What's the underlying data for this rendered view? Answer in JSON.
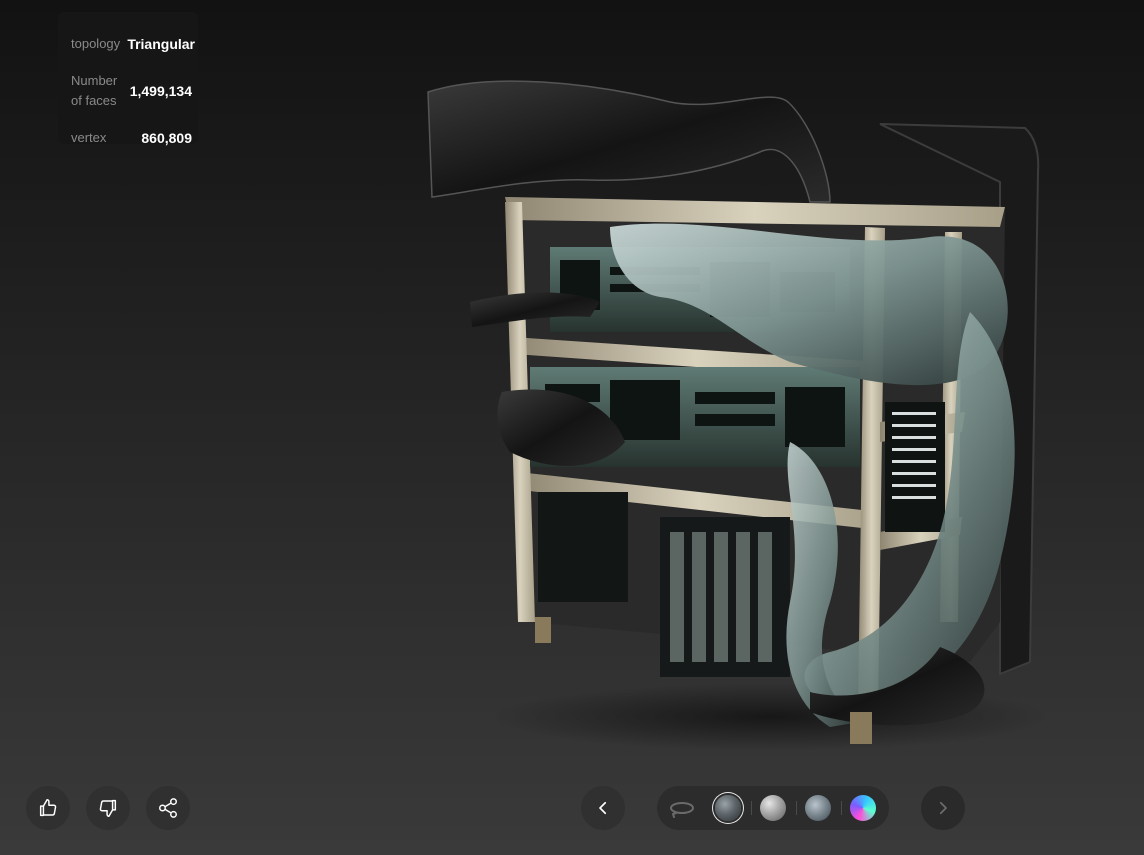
{
  "stats": {
    "topology": {
      "label": "topology",
      "value": "Triangular"
    },
    "faces": {
      "label": "Number of faces",
      "value": "1,499,134"
    },
    "vertex": {
      "label": "vertex",
      "value": "860,809"
    }
  },
  "model": {
    "subject": "server rack with cables"
  },
  "actions": {
    "like_icon": "thumbs-up-icon",
    "dislike_icon": "thumbs-down-icon",
    "share_icon": "share-icon"
  },
  "viewer_controls": {
    "prev_icon": "chevron-left-icon",
    "next_icon": "chevron-right-icon",
    "rotate_icon": "rotate-icon",
    "materials": [
      "textured",
      "clay",
      "normal",
      "rainbow"
    ],
    "selected_material": "textured"
  },
  "colors": {
    "panel_bg": "#161616",
    "button_bg": "#303030",
    "label": "#8a8a8a",
    "value": "#ffffff"
  }
}
